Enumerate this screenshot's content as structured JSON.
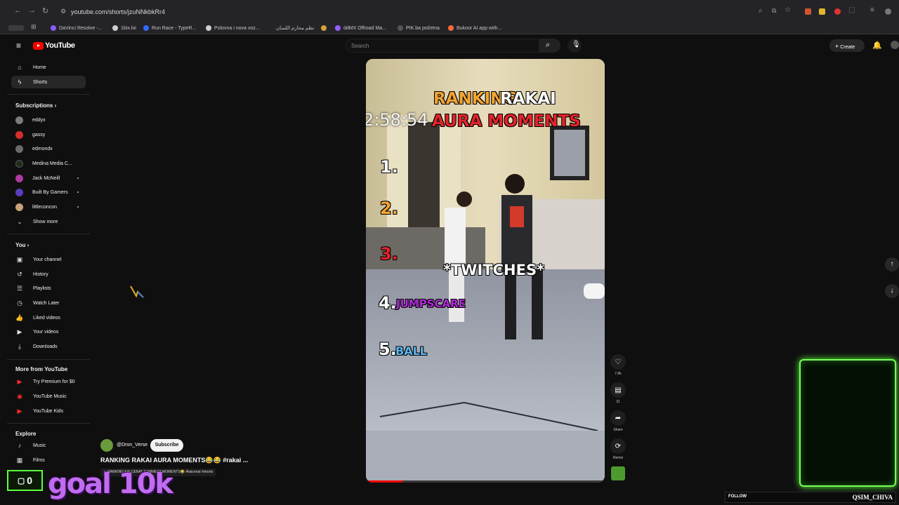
{
  "browser": {
    "url": "youtube.com/shorts/jzuNNkbkRr4",
    "bookmarks": [
      {
        "label": "DaVinci Resolve -...",
        "color": "#8a5cff"
      },
      {
        "label": "1bix.loi",
        "color": "#cfcfcf"
      },
      {
        "label": "Run Race - TypeR...",
        "color": "#2f6bff"
      },
      {
        "label": "Polovna i nova voz...",
        "color": "#cfcfcf"
      },
      {
        "label": "نظم محارم اللسان",
        "color": "#d6a035"
      },
      {
        "label": "ddMX Offroad Ma...",
        "color": "#9a5cff"
      },
      {
        "label": "PIK.ba početna",
        "color": "#222222"
      },
      {
        "label": "Bukoor AI app with...",
        "color": "#ff6a3a"
      }
    ]
  },
  "header": {
    "logo_text": "YouTube",
    "search_placeholder": "Search",
    "create_label": "Create"
  },
  "sidebar": {
    "main": [
      {
        "label": "Home",
        "icon": "home-icon"
      },
      {
        "label": "Shorts",
        "icon": "shorts-icon"
      }
    ],
    "subscriptions_title": "Subscriptions",
    "subscriptions": [
      {
        "label": "eddyx",
        "color": "#7b7b7b"
      },
      {
        "label": "gassy",
        "color": "#d92d2d"
      },
      {
        "label": "edmondx",
        "color": "#6b6b6b"
      },
      {
        "label": "Medina Media C...",
        "color": "#1e2d18"
      },
      {
        "label": "Jack McNeill",
        "color": "#b03aa0"
      },
      {
        "label": "Built By Gamers",
        "color": "#5a3dbf"
      },
      {
        "label": "littleconcon",
        "color": "#c9a27a"
      }
    ],
    "show_more": "Show more",
    "you_title": "You",
    "you_items": [
      {
        "label": "Your channel",
        "icon": "channel-icon"
      },
      {
        "label": "History",
        "icon": "history-icon"
      },
      {
        "label": "Playlists",
        "icon": "playlists-icon"
      },
      {
        "label": "Watch Later",
        "icon": "clock-icon"
      },
      {
        "label": "Liked videos",
        "icon": "thumbs-up-icon"
      },
      {
        "label": "Your videos",
        "icon": "video-icon"
      },
      {
        "label": "Downloads",
        "icon": "download-icon"
      }
    ],
    "more_title": "More from YouTube",
    "more_items": [
      {
        "label": "Try Premium for $0"
      },
      {
        "label": "YouTube Music"
      },
      {
        "label": "YouTube Kids"
      }
    ],
    "explore_title": "Explore",
    "explore_items": [
      {
        "label": "Music",
        "icon": "music-icon"
      },
      {
        "label": "Films",
        "icon": "film-icon"
      }
    ]
  },
  "video": {
    "title_line1_a": "RANKING",
    "title_line1_b": "RAKAI",
    "timer": "2:58:54",
    "title_line2": "AURA MOMENTS",
    "ranks": [
      {
        "num": "1.",
        "text": ""
      },
      {
        "num": "2.",
        "text": ""
      },
      {
        "num": "3.",
        "text": ""
      },
      {
        "num": "4.",
        "text": "JUMPSCARE"
      },
      {
        "num": "5.",
        "text": "BALL"
      }
    ],
    "caption_center": "*TWITCHES*"
  },
  "channel": {
    "handle": "@Dron_Verse",
    "subscribe_label": "Subscribe",
    "title": "RANKING RAKAI AURA MOMENTS😂😂 #rakai ...",
    "subtitle": "RANKING KAI CENAT FUNNIEST MOMENTS😂 #kaicenat #shorts"
  },
  "actions": {
    "like_count": "7.8k",
    "comment_count": "31",
    "share_label": "Share",
    "remix_label": "Remix"
  },
  "stream_overlay": {
    "counter": "0",
    "goal_text": "goal 10k",
    "follow_label": "FOLLOW",
    "streamer_name": "QSIM_CHIVA"
  }
}
